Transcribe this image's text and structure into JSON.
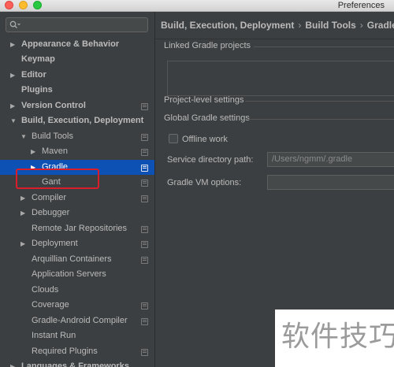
{
  "window": {
    "title": "Preferences"
  },
  "sidebar": {
    "items": [
      {
        "label": "Appearance & Behavior",
        "arrow": "▶",
        "bold": true
      },
      {
        "label": "Keymap",
        "arrow": "",
        "bold": true
      },
      {
        "label": "Editor",
        "arrow": "▶",
        "bold": true
      },
      {
        "label": "Plugins",
        "arrow": "",
        "bold": true
      },
      {
        "label": "Version Control",
        "arrow": "▶",
        "bold": true
      },
      {
        "label": "Build, Execution, Deployment",
        "arrow": "▼",
        "bold": true
      },
      {
        "label": "Build Tools",
        "arrow": "▼",
        "bold": false
      },
      {
        "label": "Maven",
        "arrow": "▶",
        "bold": false
      },
      {
        "label": "Gradle",
        "arrow": "▶",
        "bold": false
      },
      {
        "label": "Gant",
        "arrow": "",
        "bold": false
      },
      {
        "label": "Compiler",
        "arrow": "▶",
        "bold": false
      },
      {
        "label": "Debugger",
        "arrow": "▶",
        "bold": false
      },
      {
        "label": "Remote Jar Repositories",
        "arrow": "",
        "bold": false
      },
      {
        "label": "Deployment",
        "arrow": "▶",
        "bold": false
      },
      {
        "label": "Arquillian Containers",
        "arrow": "",
        "bold": false
      },
      {
        "label": "Application Servers",
        "arrow": "",
        "bold": false
      },
      {
        "label": "Clouds",
        "arrow": "",
        "bold": false
      },
      {
        "label": "Coverage",
        "arrow": "",
        "bold": false
      },
      {
        "label": "Gradle-Android Compiler",
        "arrow": "",
        "bold": false
      },
      {
        "label": "Instant Run",
        "arrow": "",
        "bold": false
      },
      {
        "label": "Required Plugins",
        "arrow": "",
        "bold": false
      },
      {
        "label": "Languages & Frameworks",
        "arrow": "▶",
        "bold": true
      }
    ]
  },
  "breadcrumb": [
    "Build, Execution, Deployment",
    "Build Tools",
    "Gradle"
  ],
  "breadcrumb_sep": "›",
  "main": {
    "linked_projects_label": "Linked Gradle projects",
    "project_level_label": "Project-level settings",
    "global_label": "Global Gradle settings",
    "offline_work_label": "Offline work",
    "service_dir_label": "Service directory path:",
    "service_dir_value": "/Users/ngmm/.gradle",
    "vm_options_label": "Gradle VM options:",
    "vm_options_value": ""
  },
  "watermark": {
    "text": "软件技巧"
  },
  "colors": {
    "selection": "#0d51b5",
    "highlight_border": "#d91e2a",
    "background": "#3c3f41",
    "text": "#bbbbbb"
  }
}
